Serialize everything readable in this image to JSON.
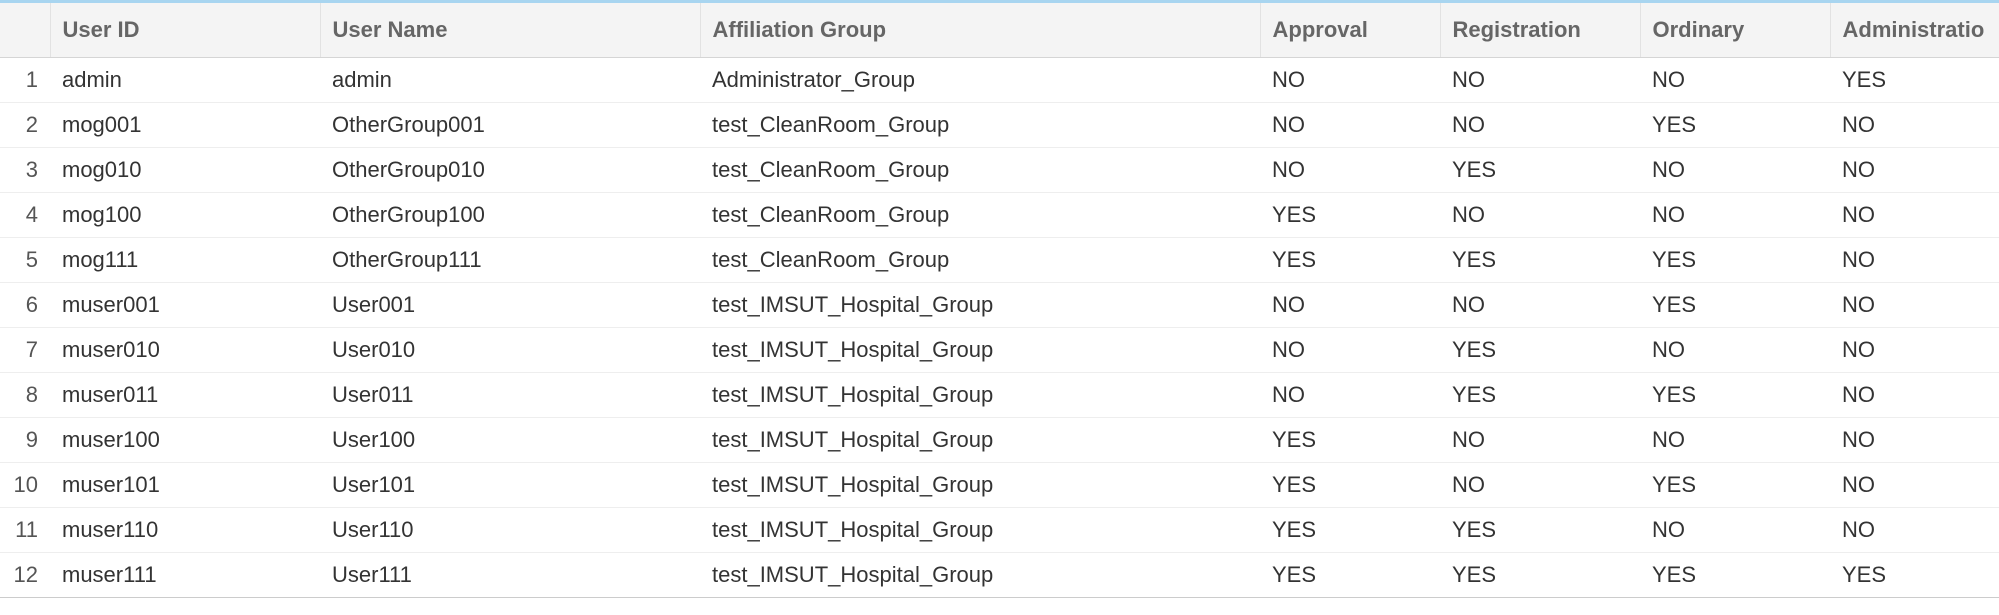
{
  "columns": {
    "rownum": "",
    "user_id": "User ID",
    "user_name": "User Name",
    "affiliation_group": "Affiliation Group",
    "approval": "Approval",
    "registration": "Registration",
    "ordinary": "Ordinary",
    "administration": "Administratio"
  },
  "rows": [
    {
      "n": "1",
      "user_id": "admin",
      "user_name": "admin",
      "affiliation_group": "Administrator_Group",
      "approval": "NO",
      "registration": "NO",
      "ordinary": "NO",
      "administration": "YES"
    },
    {
      "n": "2",
      "user_id": "mog001",
      "user_name": "OtherGroup001",
      "affiliation_group": "test_CleanRoom_Group",
      "approval": "NO",
      "registration": "NO",
      "ordinary": "YES",
      "administration": "NO"
    },
    {
      "n": "3",
      "user_id": "mog010",
      "user_name": "OtherGroup010",
      "affiliation_group": "test_CleanRoom_Group",
      "approval": "NO",
      "registration": "YES",
      "ordinary": "NO",
      "administration": "NO"
    },
    {
      "n": "4",
      "user_id": "mog100",
      "user_name": "OtherGroup100",
      "affiliation_group": "test_CleanRoom_Group",
      "approval": "YES",
      "registration": "NO",
      "ordinary": "NO",
      "administration": "NO"
    },
    {
      "n": "5",
      "user_id": "mog111",
      "user_name": "OtherGroup111",
      "affiliation_group": "test_CleanRoom_Group",
      "approval": "YES",
      "registration": "YES",
      "ordinary": "YES",
      "administration": "NO"
    },
    {
      "n": "6",
      "user_id": "muser001",
      "user_name": "User001",
      "affiliation_group": "test_IMSUT_Hospital_Group",
      "approval": "NO",
      "registration": "NO",
      "ordinary": "YES",
      "administration": "NO"
    },
    {
      "n": "7",
      "user_id": "muser010",
      "user_name": "User010",
      "affiliation_group": "test_IMSUT_Hospital_Group",
      "approval": "NO",
      "registration": "YES",
      "ordinary": "NO",
      "administration": "NO"
    },
    {
      "n": "8",
      "user_id": "muser011",
      "user_name": "User011",
      "affiliation_group": "test_IMSUT_Hospital_Group",
      "approval": "NO",
      "registration": "YES",
      "ordinary": "YES",
      "administration": "NO"
    },
    {
      "n": "9",
      "user_id": "muser100",
      "user_name": "User100",
      "affiliation_group": "test_IMSUT_Hospital_Group",
      "approval": "YES",
      "registration": "NO",
      "ordinary": "NO",
      "administration": "NO"
    },
    {
      "n": "10",
      "user_id": "muser101",
      "user_name": "User101",
      "affiliation_group": "test_IMSUT_Hospital_Group",
      "approval": "YES",
      "registration": "NO",
      "ordinary": "YES",
      "administration": "NO"
    },
    {
      "n": "11",
      "user_id": "muser110",
      "user_name": "User110",
      "affiliation_group": "test_IMSUT_Hospital_Group",
      "approval": "YES",
      "registration": "YES",
      "ordinary": "NO",
      "administration": "NO"
    },
    {
      "n": "12",
      "user_id": "muser111",
      "user_name": "User111",
      "affiliation_group": "test_IMSUT_Hospital_Group",
      "approval": "YES",
      "registration": "YES",
      "ordinary": "YES",
      "administration": "YES"
    }
  ]
}
